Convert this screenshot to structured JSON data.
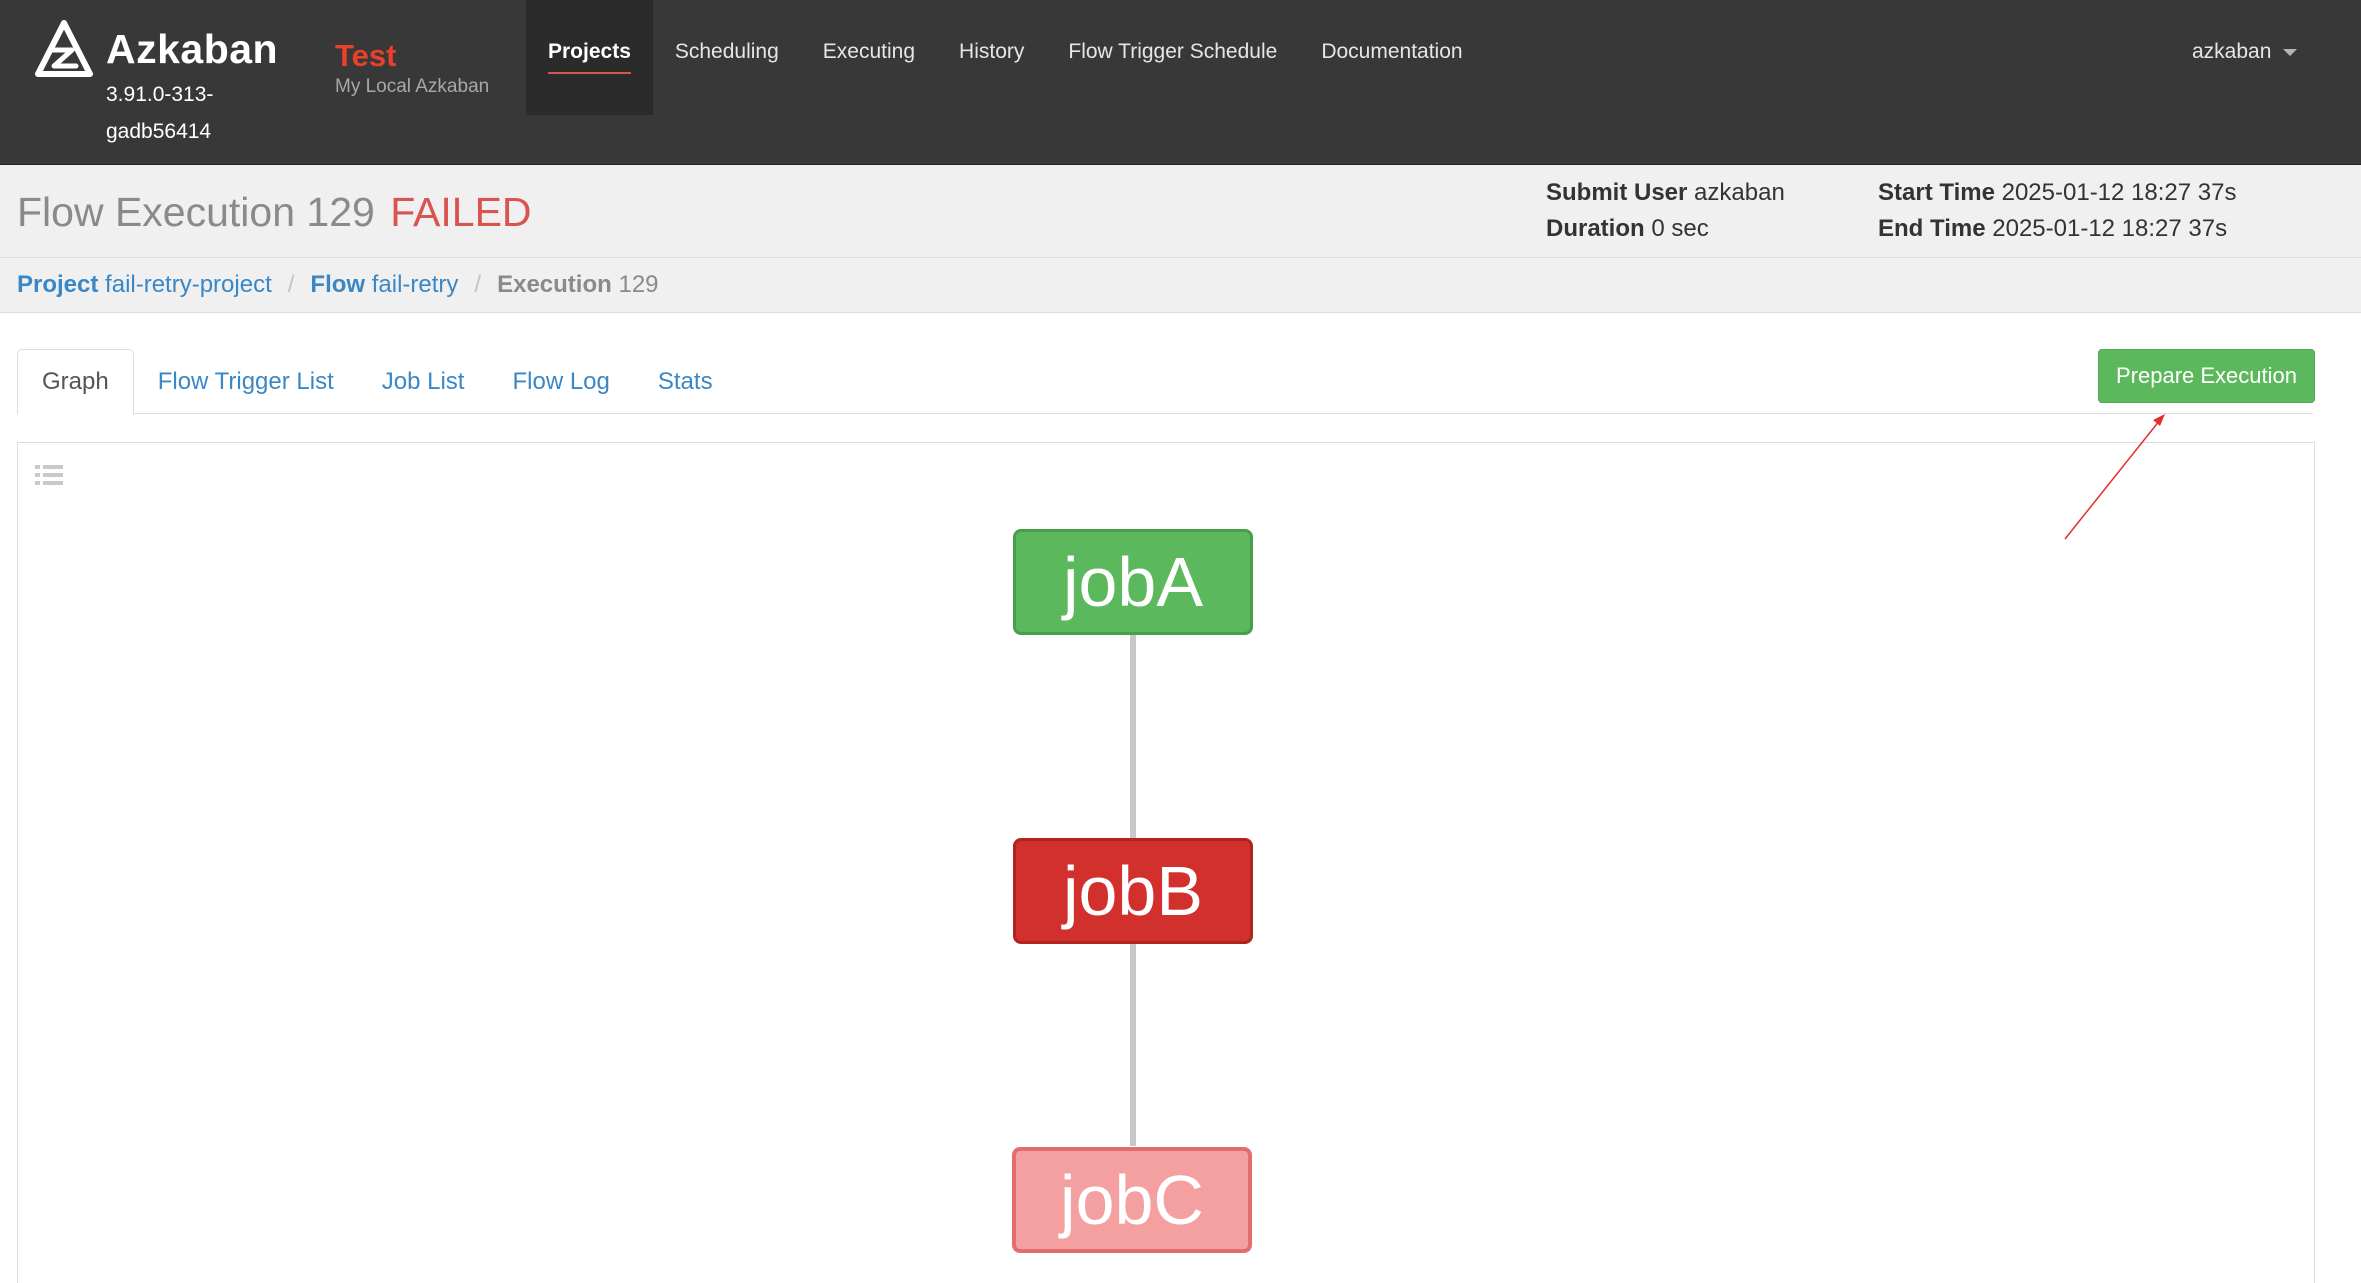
{
  "app": {
    "brand": "Azkaban",
    "version": "3.91.0-313-gadb56414",
    "env_name": "Test",
    "env_desc": "My Local Azkaban"
  },
  "nav": {
    "items": [
      {
        "label": "Projects",
        "active": true
      },
      {
        "label": "Scheduling",
        "active": false
      },
      {
        "label": "Executing",
        "active": false
      },
      {
        "label": "History",
        "active": false
      },
      {
        "label": "Flow Trigger Schedule",
        "active": false
      },
      {
        "label": "Documentation",
        "active": false
      }
    ],
    "user": "azkaban"
  },
  "execution": {
    "title_prefix": "Flow Execution",
    "id": "129",
    "status": "FAILED",
    "status_color": "#d9534f",
    "submit_user_label": "Submit User",
    "submit_user": "azkaban",
    "duration_label": "Duration",
    "duration": "0 sec",
    "start_time_label": "Start Time",
    "start_time": "2025-01-12 18:27 37s",
    "end_time_label": "End Time",
    "end_time": "2025-01-12 18:27 37s"
  },
  "breadcrumb": {
    "project_label": "Project",
    "project": "fail-retry-project",
    "flow_label": "Flow",
    "flow": "fail-retry",
    "execution_label": "Execution",
    "execution": "129"
  },
  "tabs": [
    {
      "label": "Graph",
      "active": true
    },
    {
      "label": "Flow Trigger List",
      "active": false
    },
    {
      "label": "Job List",
      "active": false
    },
    {
      "label": "Flow Log",
      "active": false
    },
    {
      "label": "Stats",
      "active": false
    }
  ],
  "actions": {
    "prepare_execution": "Prepare Execution",
    "button_color": "#5cb85c"
  },
  "graph": {
    "nodes": [
      {
        "id": "jobA",
        "status": "succeeded",
        "color": "#5cb85c"
      },
      {
        "id": "jobB",
        "status": "failed",
        "color": "#d1302d"
      },
      {
        "id": "jobC",
        "status": "killed",
        "color": "#f4a0a0"
      }
    ],
    "edges": [
      {
        "from": "jobA",
        "to": "jobB"
      },
      {
        "from": "jobB",
        "to": "jobC"
      }
    ]
  }
}
